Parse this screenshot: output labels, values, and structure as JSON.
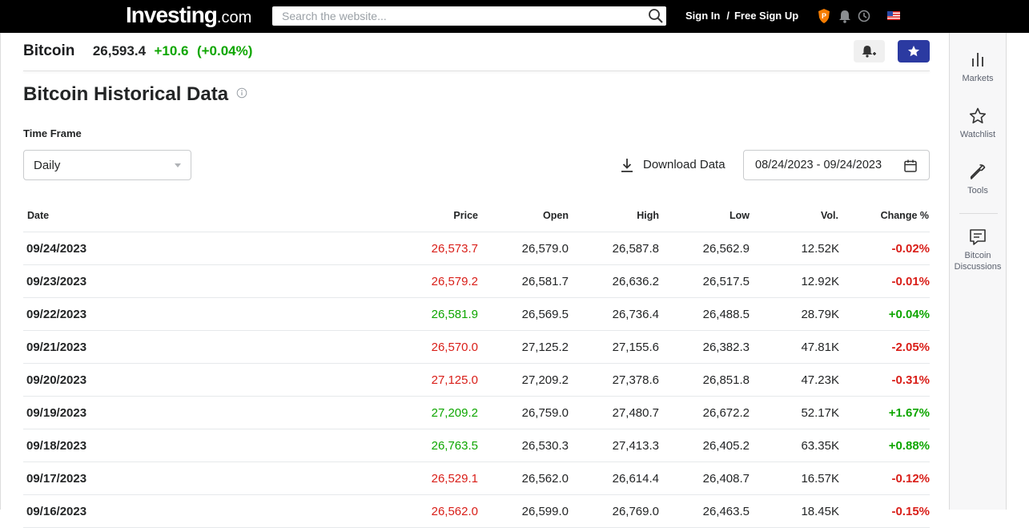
{
  "topbar": {
    "logo_main": "Investing",
    "logo_suffix": ".com",
    "search_placeholder": "Search the website...",
    "sign_in": "Sign In",
    "separator": "/",
    "sign_up": "Free Sign Up"
  },
  "instrument": {
    "name": "Bitcoin",
    "price": "26,593.4",
    "change": "+10.6",
    "change_pct": "(+0.04%)"
  },
  "page": {
    "title": "Bitcoin Historical Data",
    "time_frame_label": "Time Frame",
    "time_frame_value": "Daily",
    "download_label": "Download Data",
    "date_range": "08/24/2023 - 09/24/2023"
  },
  "table": {
    "headers": {
      "date": "Date",
      "price": "Price",
      "open": "Open",
      "high": "High",
      "low": "Low",
      "vol": "Vol.",
      "change": "Change %"
    },
    "rows": [
      {
        "date": "09/24/2023",
        "price": "26,573.7",
        "open": "26,579.0",
        "high": "26,587.8",
        "low": "26,562.9",
        "vol": "12.52K",
        "change": "-0.02%",
        "dir": "down"
      },
      {
        "date": "09/23/2023",
        "price": "26,579.2",
        "open": "26,581.7",
        "high": "26,636.2",
        "low": "26,517.5",
        "vol": "12.92K",
        "change": "-0.01%",
        "dir": "down"
      },
      {
        "date": "09/22/2023",
        "price": "26,581.9",
        "open": "26,569.5",
        "high": "26,736.4",
        "low": "26,488.5",
        "vol": "28.79K",
        "change": "+0.04%",
        "dir": "up"
      },
      {
        "date": "09/21/2023",
        "price": "26,570.0",
        "open": "27,125.2",
        "high": "27,155.6",
        "low": "26,382.3",
        "vol": "47.81K",
        "change": "-2.05%",
        "dir": "down"
      },
      {
        "date": "09/20/2023",
        "price": "27,125.0",
        "open": "27,209.2",
        "high": "27,378.6",
        "low": "26,851.8",
        "vol": "47.23K",
        "change": "-0.31%",
        "dir": "down"
      },
      {
        "date": "09/19/2023",
        "price": "27,209.2",
        "open": "26,759.0",
        "high": "27,480.7",
        "low": "26,672.2",
        "vol": "52.17K",
        "change": "+1.67%",
        "dir": "up"
      },
      {
        "date": "09/18/2023",
        "price": "26,763.5",
        "open": "26,530.3",
        "high": "27,413.3",
        "low": "26,405.2",
        "vol": "63.35K",
        "change": "+0.88%",
        "dir": "up"
      },
      {
        "date": "09/17/2023",
        "price": "26,529.1",
        "open": "26,562.0",
        "high": "26,614.4",
        "low": "26,408.7",
        "vol": "16.57K",
        "change": "-0.12%",
        "dir": "down"
      },
      {
        "date": "09/16/2023",
        "price": "26,562.0",
        "open": "26,599.0",
        "high": "26,769.0",
        "low": "26,463.5",
        "vol": "18.45K",
        "change": "-0.15%",
        "dir": "down"
      }
    ]
  },
  "sidebar": {
    "items": [
      {
        "label": "Markets",
        "icon": "bar-chart-icon"
      },
      {
        "label": "Watchlist",
        "icon": "star-outline-icon"
      },
      {
        "label": "Tools",
        "icon": "wrench-icon"
      },
      {
        "label": "Bitcoin Discussions",
        "icon": "comment-icon"
      }
    ]
  },
  "colors": {
    "up": "#0ea600",
    "down": "#d91e18",
    "brand_button": "#2b3aa1",
    "topbar": "#000000"
  }
}
